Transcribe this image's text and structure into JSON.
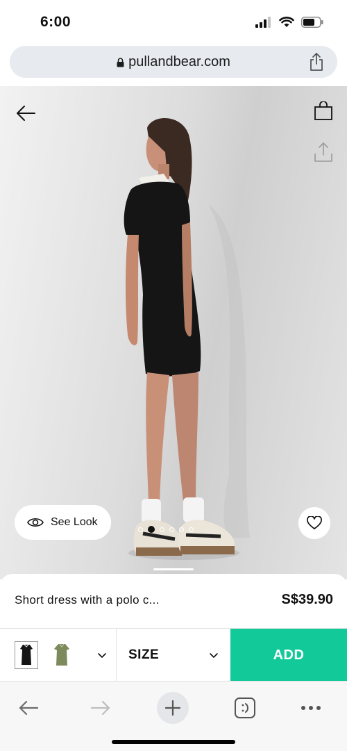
{
  "status_bar": {
    "time": "6:00"
  },
  "browser": {
    "url": "pullandbear.com"
  },
  "hero": {
    "see_look_label": "See Look",
    "image_count": 6,
    "active_image": 1
  },
  "product": {
    "name": "Short dress with a polo c...",
    "price": "S$39.90"
  },
  "actions": {
    "size_label": "SIZE",
    "add_label": "ADD"
  },
  "colors": {
    "accent": "#12c99a",
    "url_bar": "#e7eaee"
  }
}
